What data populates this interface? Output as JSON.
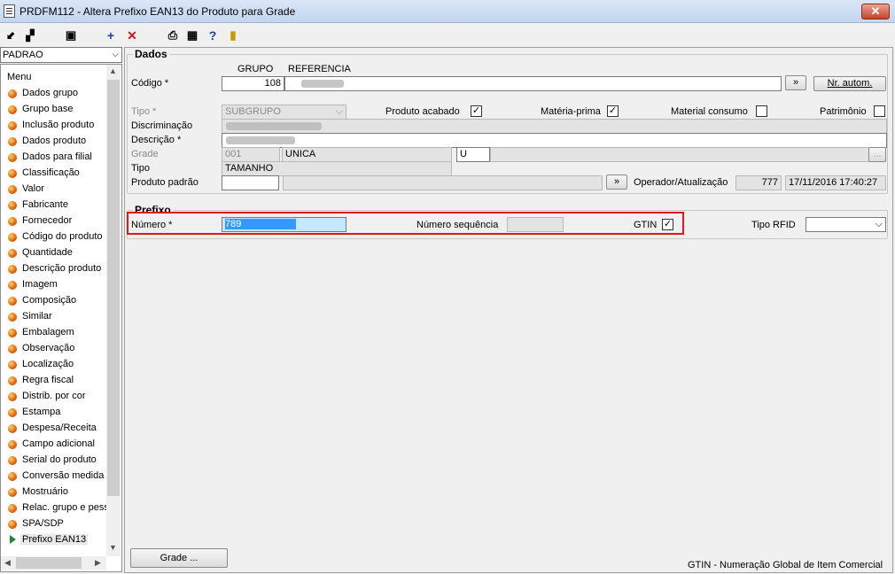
{
  "window": {
    "title": "PRDFM112 - Altera Prefixo EAN13 do Produto para Grade",
    "close": "✕"
  },
  "left": {
    "combo_value": "PADRAO",
    "menu_title": "Menu",
    "items": [
      "Dados grupo",
      "Grupo base",
      "Inclusão produto",
      "Dados produto",
      "Dados para filial",
      "Classificação",
      "Valor",
      "Fabricante",
      "Fornecedor",
      "Código do produto",
      "Quantidade",
      "Descrição produto",
      "Imagem",
      "Composição",
      "Similar",
      "Embalagem",
      "Observação",
      "Localização",
      "Regra fiscal",
      "Distrib. por cor",
      "Estampa",
      "Despesa/Receita",
      "Campo adicional",
      "Serial do produto",
      "Conversão medida",
      "Mostruário",
      "Relac. grupo e pess",
      "SPA/SDP",
      "Prefixo EAN13"
    ],
    "selected_item": "Prefixo EAN13"
  },
  "dados": {
    "section_title": "Dados",
    "col_grupo": "GRUPO",
    "col_referencia": "REFERENCIA",
    "codigo_label": "Código *",
    "grupo_value": "108",
    "browse_btn": "»",
    "nr_autom_btn": "Nr. autom.",
    "tipo_label": "Tipo *",
    "tipo_value": "SUBGRUPO",
    "produto_acabado_label": "Produto acabado",
    "produto_acabado": "✓",
    "materia_prima_label": "Matéria-prima",
    "materia_prima": "✓",
    "material_consumo_label": "Material consumo",
    "patrimonio_label": "Patrimônio",
    "discriminacao_label": "Discriminação",
    "descricao_label": "Descrição *",
    "grade_label": "Grade",
    "grade_code": "001",
    "grade_name": "UNICA",
    "grade_u": "U",
    "grade_dots": "...",
    "tipo2_label": "Tipo",
    "tipo2_value": "TAMANHO",
    "produto_padrao_label": "Produto padrão",
    "browse_btn2": "»",
    "operador_label": "Operador/Atualização",
    "operador_value": "777",
    "data_value": "17/11/2016 17:40:27"
  },
  "prefixo": {
    "section_title": "Prefixo",
    "numero_label": "Número *",
    "numero_value": "789",
    "sequencia_label": "Número sequência",
    "gtin_label": "GTIN",
    "gtin_check": "✓",
    "tipo_rfid_label": "Tipo RFID"
  },
  "footer": {
    "grade_btn": "Grade ...",
    "status": "GTIN - Numeração Global de Item Comercial"
  },
  "colors": {
    "highlight": "#e01818",
    "selection": "#3399ff",
    "accent_icon": "#1a3fb8"
  }
}
